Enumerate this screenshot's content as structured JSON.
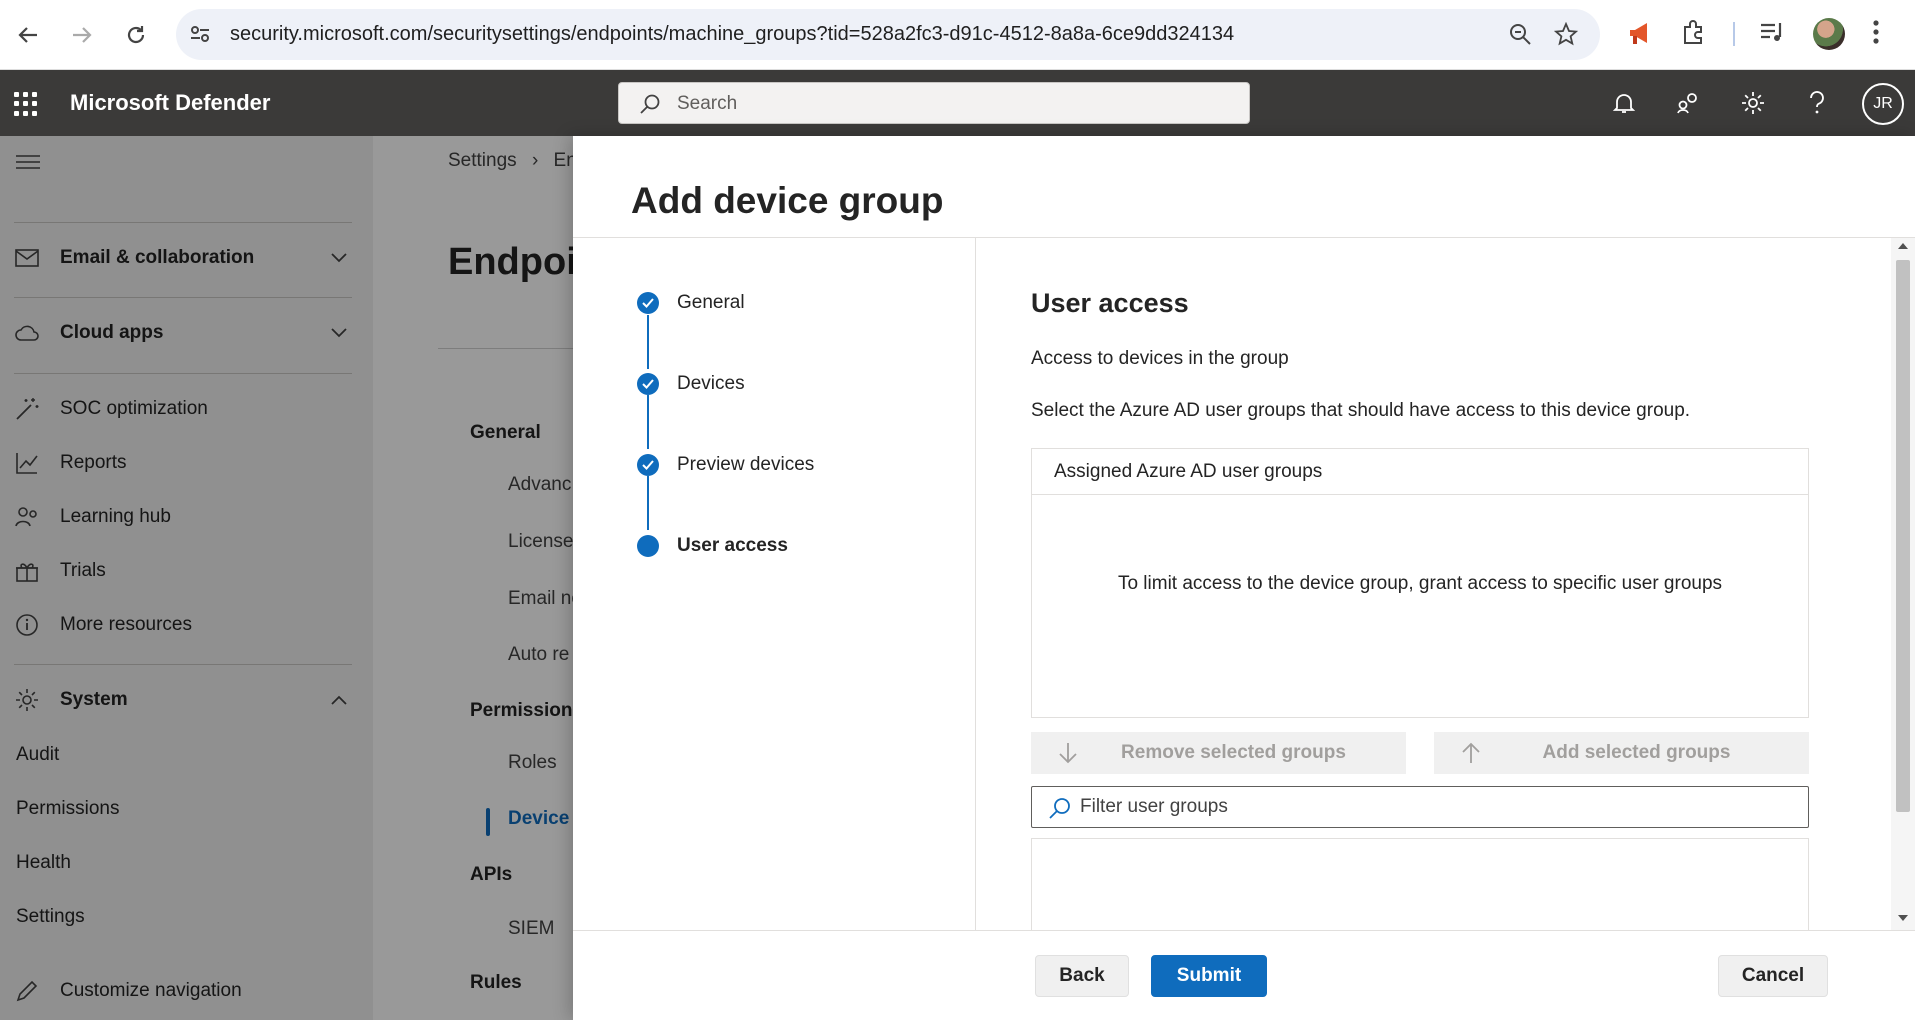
{
  "browser": {
    "url": "security.microsoft.com/securitysettings/endpoints/machine_groups?tid=528a2fc3-d91c-4512-8a8a-6ce9dd324134"
  },
  "header": {
    "app_title": "Microsoft Defender",
    "search_placeholder": "Search",
    "user_initials": "JR"
  },
  "sidebar": {
    "items": [
      {
        "label": "Email & collaboration",
        "icon": "mail-icon"
      },
      {
        "label": "Cloud apps",
        "icon": "cloud-icon"
      },
      {
        "label": "SOC optimization",
        "icon": "wand-icon"
      },
      {
        "label": "Reports",
        "icon": "chart-icon"
      },
      {
        "label": "Learning hub",
        "icon": "people-icon"
      },
      {
        "label": "Trials",
        "icon": "gift-icon"
      },
      {
        "label": "More resources",
        "icon": "info-icon"
      },
      {
        "label": "System",
        "icon": "gear-icon"
      },
      {
        "label": "Audit"
      },
      {
        "label": "Permissions"
      },
      {
        "label": "Health"
      },
      {
        "label": "Settings"
      },
      {
        "label": "Customize navigation",
        "icon": "pencil-icon"
      }
    ]
  },
  "background_page": {
    "breadcrumb_root": "Settings",
    "breadcrumb_next": "End",
    "title": "Endpoi",
    "sections": {
      "general": "General",
      "advanced": "Advanc",
      "licenses": "Licenses",
      "email": "Email no",
      "auto": "Auto re",
      "permissions": "Permissions",
      "roles": "Roles",
      "device": "Device",
      "apis": "APIs",
      "siem": "SIEM",
      "rules": "Rules"
    }
  },
  "panel": {
    "title": "Add device group",
    "steps": [
      {
        "label": "General",
        "state": "done"
      },
      {
        "label": "Devices",
        "state": "done"
      },
      {
        "label": "Preview devices",
        "state": "done"
      },
      {
        "label": "User access",
        "state": "current"
      }
    ],
    "content": {
      "heading": "User access",
      "subheading": "Access to devices in the group",
      "description": "Select the Azure AD user groups that should have access to this device group.",
      "assigned_header": "Assigned Azure AD user groups",
      "empty_message": "To limit access to the device group, grant access to specific user groups",
      "remove_label": "Remove selected groups",
      "add_label": "Add selected groups",
      "filter_placeholder": "Filter user groups"
    },
    "footer": {
      "back": "Back",
      "submit": "Submit",
      "cancel": "Cancel"
    }
  },
  "colors": {
    "accent": "#0f6cbd",
    "header_bg": "#3b3a39"
  }
}
